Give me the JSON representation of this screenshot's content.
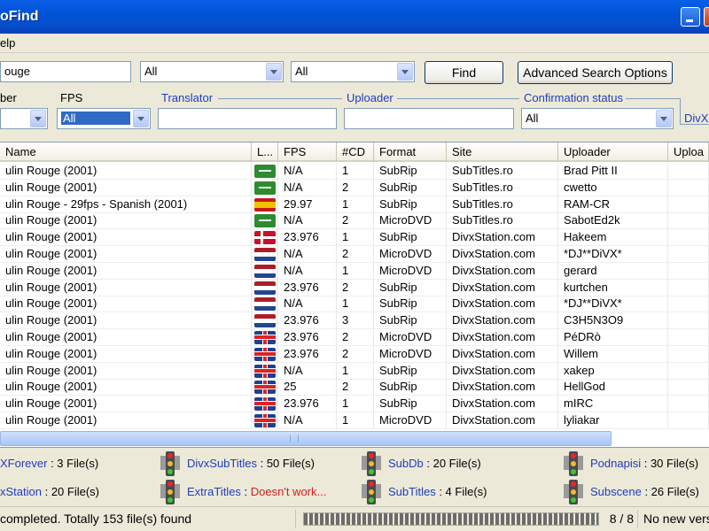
{
  "window": {
    "title": "oFind"
  },
  "menu": {
    "help": "elp"
  },
  "search": {
    "query": "ouge",
    "combo1": "All",
    "combo2": "All",
    "find_label": "Find",
    "advanced_label": "Advanced Search Options"
  },
  "filters": {
    "number_label": "ber",
    "fps_label": "FPS",
    "fps_value": "All",
    "translator_label": "Translator",
    "uploader_label": "Uploader",
    "confirmation_label": "Confirmation status",
    "confirmation_value": "All",
    "divx_label": "DivX"
  },
  "grid": {
    "columns": [
      "Name",
      "L...",
      "FPS",
      "#CD",
      "Format",
      "Site",
      "Uploader",
      "Uploa"
    ],
    "rows": [
      {
        "name": "ulin Rouge (2001)",
        "flag": "sa",
        "fps": "N/A",
        "cd": "1",
        "format": "SubRip",
        "site": "SubTitles.ro",
        "uploader": "Brad Pitt II"
      },
      {
        "name": "ulin Rouge (2001)",
        "flag": "sa",
        "fps": "N/A",
        "cd": "2",
        "format": "SubRip",
        "site": "SubTitles.ro",
        "uploader": "cwetto"
      },
      {
        "name": "ulin Rouge - 29fps - Spanish (2001)",
        "flag": "es",
        "fps": "29.97",
        "cd": "1",
        "format": "SubRip",
        "site": "SubTitles.ro",
        "uploader": "RAM-CR"
      },
      {
        "name": "ulin Rouge (2001)",
        "flag": "sa",
        "fps": "N/A",
        "cd": "2",
        "format": "MicroDVD",
        "site": "SubTitles.ro",
        "uploader": "SabotEd2k"
      },
      {
        "name": "ulin Rouge (2001)",
        "flag": "dk",
        "fps": "23.976",
        "cd": "1",
        "format": "SubRip",
        "site": "DivxStation.com",
        "uploader": "Hakeem"
      },
      {
        "name": "ulin Rouge (2001)",
        "flag": "nl",
        "fps": "N/A",
        "cd": "2",
        "format": "MicroDVD",
        "site": "DivxStation.com",
        "uploader": "*DJ**DiVX*"
      },
      {
        "name": "ulin Rouge (2001)",
        "flag": "nl",
        "fps": "N/A",
        "cd": "1",
        "format": "MicroDVD",
        "site": "DivxStation.com",
        "uploader": "gerard"
      },
      {
        "name": "ulin Rouge (2001)",
        "flag": "nl",
        "fps": "23.976",
        "cd": "2",
        "format": "SubRip",
        "site": "DivxStation.com",
        "uploader": "kurtchen"
      },
      {
        "name": "ulin Rouge (2001)",
        "flag": "nl",
        "fps": "N/A",
        "cd": "1",
        "format": "SubRip",
        "site": "DivxStation.com",
        "uploader": "*DJ**DiVX*"
      },
      {
        "name": "ulin Rouge (2001)",
        "flag": "nl",
        "fps": "23.976",
        "cd": "3",
        "format": "SubRip",
        "site": "DivxStation.com",
        "uploader": "C3H5N3O9"
      },
      {
        "name": "ulin Rouge (2001)",
        "flag": "uk",
        "fps": "23.976",
        "cd": "2",
        "format": "MicroDVD",
        "site": "DivxStation.com",
        "uploader": "PéDRò"
      },
      {
        "name": "ulin Rouge (2001)",
        "flag": "uk",
        "fps": "23.976",
        "cd": "2",
        "format": "MicroDVD",
        "site": "DivxStation.com",
        "uploader": "Willem"
      },
      {
        "name": "ulin Rouge (2001)",
        "flag": "uk",
        "fps": "N/A",
        "cd": "1",
        "format": "SubRip",
        "site": "DivxStation.com",
        "uploader": "xakep"
      },
      {
        "name": "ulin Rouge (2001)",
        "flag": "uk",
        "fps": "25",
        "cd": "2",
        "format": "SubRip",
        "site": "DivxStation.com",
        "uploader": "HellGod"
      },
      {
        "name": "ulin Rouge (2001)",
        "flag": "uk",
        "fps": "23.976",
        "cd": "1",
        "format": "SubRip",
        "site": "DivxStation.com",
        "uploader": "mIRC"
      },
      {
        "name": "ulin Rouge (2001)",
        "flag": "uk",
        "fps": "N/A",
        "cd": "1",
        "format": "MicroDVD",
        "site": "DivxStation.com",
        "uploader": "lyliakar"
      }
    ]
  },
  "sources": {
    "s1": {
      "name": "XForever",
      "count": " : 3 File(s)"
    },
    "s2": {
      "name": "DivxSubTitles",
      "count": " : 50 File(s)"
    },
    "s3": {
      "name": "SubDb",
      "count": " : 20 File(s)"
    },
    "s4": {
      "name": "Podnapisi",
      "count": " : 30 File(s)"
    },
    "s5": {
      "name": "xStation",
      "count": " : 20 File(s)"
    },
    "s6": {
      "name": "ExtraTitles",
      "count": " : ",
      "error": "Doesn't work..."
    },
    "s7": {
      "name": "SubTitles",
      "count": " : 4 File(s)"
    },
    "s8": {
      "name": "Subscene",
      "count": " : 26 File(s)"
    }
  },
  "status": {
    "message": "completed. Totally 153 file(s) found",
    "pages": "8 / 8",
    "version": "No new vers"
  }
}
